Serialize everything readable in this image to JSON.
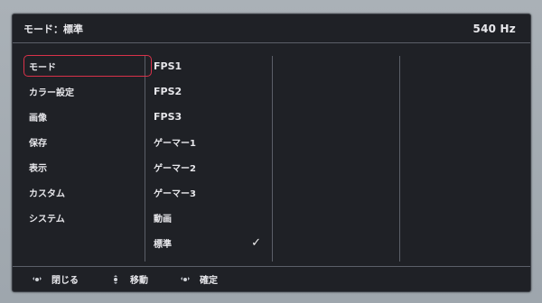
{
  "header": {
    "title": "モード：標準",
    "refresh_rate": "540 Hz"
  },
  "menu": {
    "items": [
      {
        "label": "モード",
        "selected": true
      },
      {
        "label": "カラー設定",
        "selected": false
      },
      {
        "label": "画像",
        "selected": false
      },
      {
        "label": "保存",
        "selected": false
      },
      {
        "label": "表示",
        "selected": false
      },
      {
        "label": "カスタム",
        "selected": false
      },
      {
        "label": "システム",
        "selected": false
      }
    ]
  },
  "submenu": {
    "items": [
      {
        "label": "FPS1",
        "checked": false
      },
      {
        "label": "FPS2",
        "checked": false
      },
      {
        "label": "FPS3",
        "checked": false
      },
      {
        "label": "ゲーマー1",
        "checked": false
      },
      {
        "label": "ゲーマー2",
        "checked": false
      },
      {
        "label": "ゲーマー3",
        "checked": false
      },
      {
        "label": "動画",
        "checked": false
      },
      {
        "label": "標準",
        "checked": true
      }
    ],
    "check_glyph": "✓"
  },
  "footer": {
    "close_label": "閉じる",
    "move_label": "移動",
    "confirm_label": "確定"
  },
  "colors": {
    "background": "#1f2126",
    "selection_border": "#d9324a",
    "divider": "#5b5f68",
    "text": "#e6e6ea"
  },
  "icons": {
    "close": "dpad-left-right-icon",
    "move": "dpad-up-down-icon",
    "confirm": "dpad-center-icon"
  }
}
